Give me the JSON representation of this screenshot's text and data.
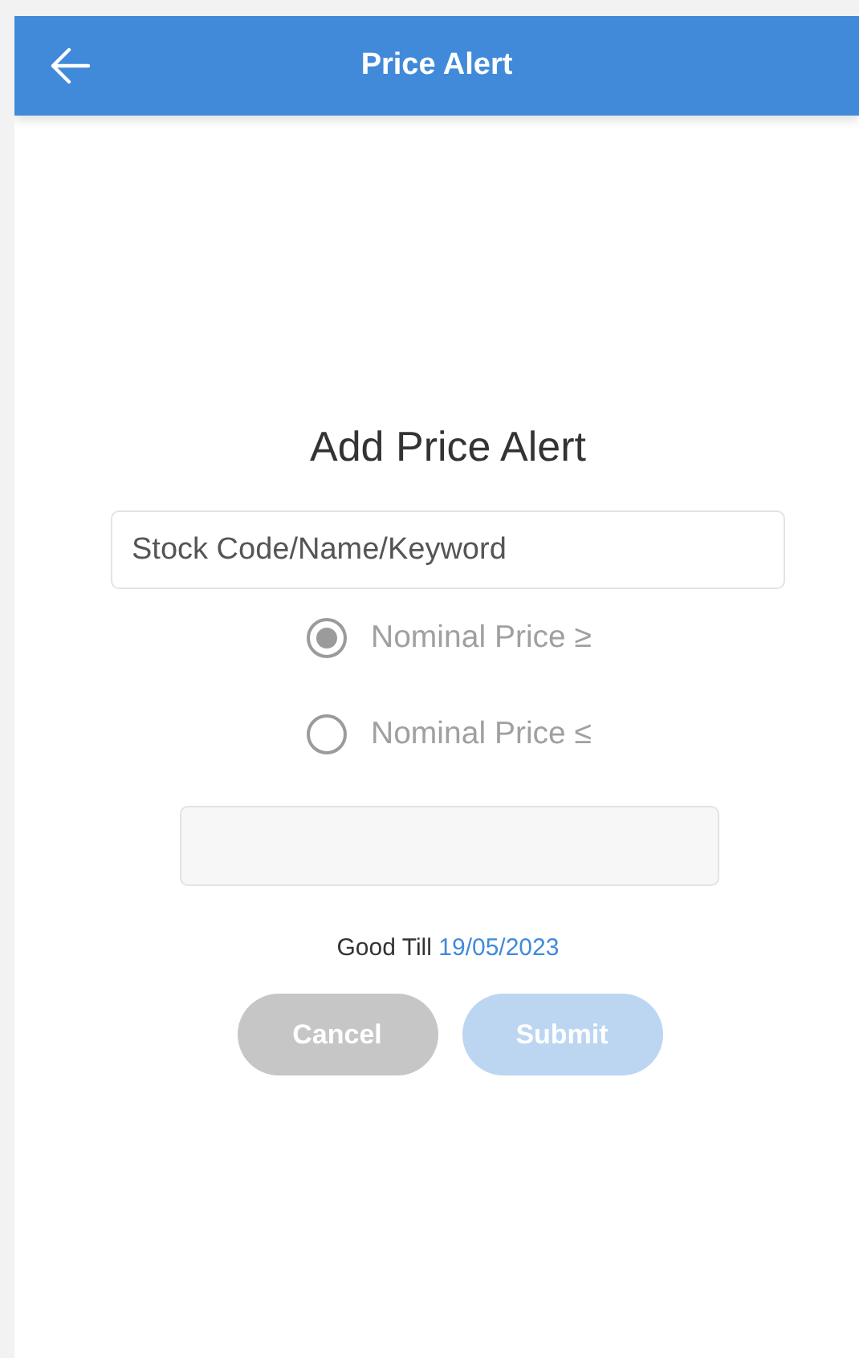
{
  "header": {
    "title": "Price Alert"
  },
  "form": {
    "heading": "Add Price Alert",
    "search": {
      "placeholder": "Stock Code/Name/Keyword"
    },
    "conditions": [
      {
        "label": "Nominal Price ≥",
        "selected": true
      },
      {
        "label": "Nominal Price ≤",
        "selected": false
      }
    ],
    "good_till": {
      "label": "Good Till",
      "date": "19/05/2023"
    },
    "buttons": [
      {
        "kind": "cancel",
        "label": "Cancel",
        "disabled": false
      },
      {
        "kind": "submit",
        "label": "Submit",
        "disabled": true
      }
    ]
  }
}
